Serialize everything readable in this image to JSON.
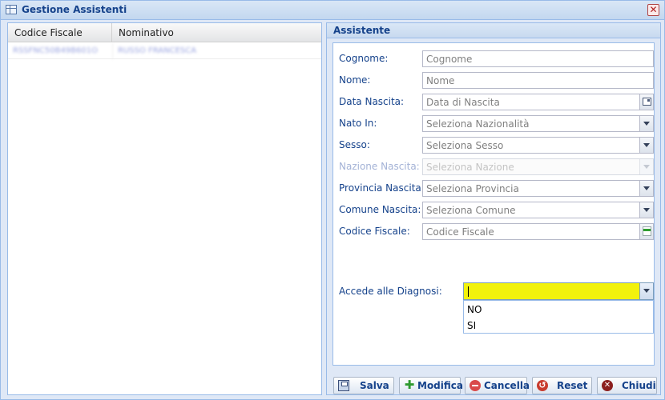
{
  "window": {
    "title": "Gestione Assistenti",
    "close_glyph": "✕"
  },
  "grid": {
    "columns": [
      "Codice Fiscale",
      "Nominativo"
    ],
    "rows": [
      {
        "codice_fiscale": "RSSFNC50B49B601O",
        "nominativo": "RUSSO FRANCESCA"
      }
    ]
  },
  "form": {
    "title": "Assistente",
    "fields": [
      {
        "label": "Cognome:",
        "placeholder": "Cognome"
      },
      {
        "label": "Nome:",
        "placeholder": "Nome"
      },
      {
        "label": "Data Nascita:",
        "placeholder": "Data di Nascita"
      },
      {
        "label": "Nato In:",
        "placeholder": "Seleziona Nazionalità"
      },
      {
        "label": "Sesso:",
        "placeholder": "Seleziona Sesso"
      },
      {
        "label": "Nazione Nascita:",
        "placeholder": "Seleziona Nazione"
      },
      {
        "label": "Provincia Nascita:",
        "placeholder": "Seleziona Provincia"
      },
      {
        "label": "Comune Nascita:",
        "placeholder": "Seleziona Comune"
      },
      {
        "label": "Codice Fiscale:",
        "placeholder": "Codice Fiscale"
      }
    ],
    "diagnosi": {
      "label": "Accede alle Diagnosi:",
      "value": "",
      "options": [
        "NO",
        "SI"
      ],
      "highlight_color": "#f2f20c"
    }
  },
  "buttons": {
    "save": "Salva",
    "edit": "Modifica",
    "cancel": "Cancella",
    "reset": "Reset",
    "close": "Chiudi"
  },
  "icons": {
    "window": "table-icon",
    "close": "close-icon",
    "calendar": "calendar-icon",
    "generate": "generate-code-icon",
    "save": "floppy-icon",
    "edit": "plus-icon",
    "cancel": "minus-circle-icon",
    "reset": "reset-icon",
    "close_btn": "close-circle-icon"
  },
  "colors": {
    "accent": "#15428b",
    "border": "#99bbe8",
    "panel_bg": "#dfe8f6"
  }
}
